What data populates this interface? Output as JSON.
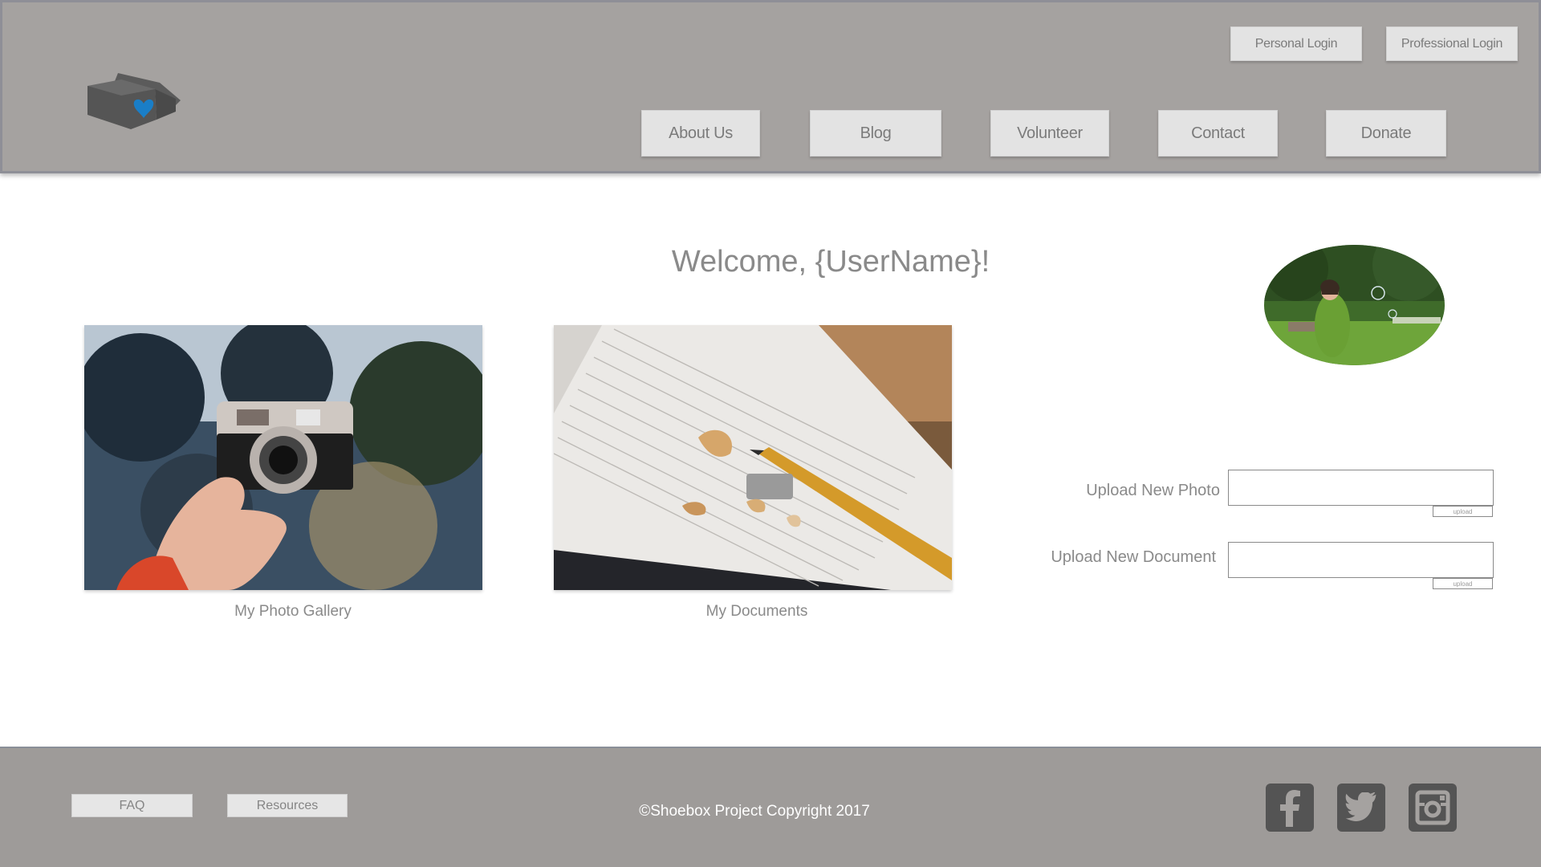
{
  "header": {
    "logo_icon": "shoebox-heart-logo",
    "accent_color": "#1a7ec7",
    "login_buttons": [
      "Personal Login",
      "Professional Login"
    ],
    "nav": [
      "About Us",
      "Blog",
      "Volunteer",
      "Contact",
      "Donate"
    ]
  },
  "main": {
    "welcome": "Welcome, {UserName}!",
    "tiles": [
      {
        "caption": "My Photo Gallery",
        "image": "camera-photo"
      },
      {
        "caption": "My Documents",
        "image": "notebook-pencil-photo"
      }
    ],
    "avatar": "child-with-bubbles-photo",
    "upload": {
      "photo_label": "Upload New Photo",
      "document_label": "Upload New Document",
      "button_label": "upload"
    }
  },
  "footer": {
    "links": [
      "FAQ",
      "Resources"
    ],
    "copyright": "©Shoebox Project Copyright 2017",
    "social": [
      "facebook-icon",
      "twitter-icon",
      "instagram-icon"
    ]
  }
}
